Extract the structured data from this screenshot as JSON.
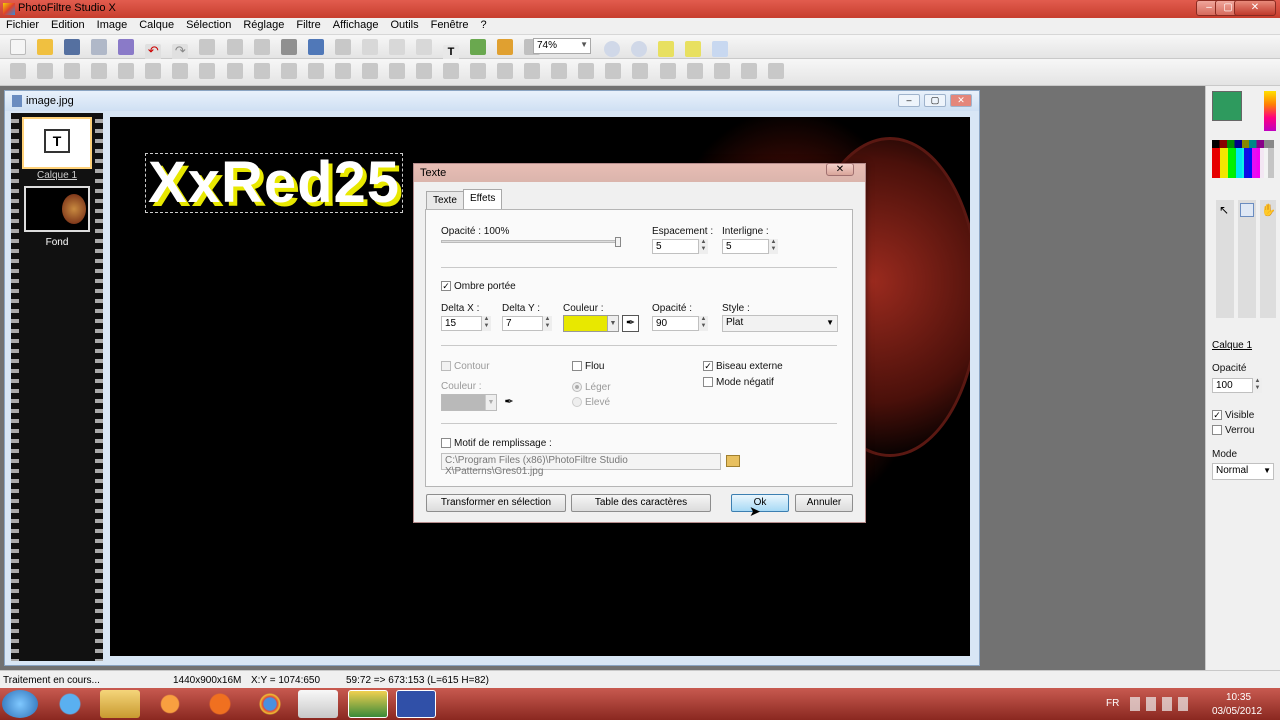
{
  "app": {
    "title": "PhotoFiltre Studio X",
    "win_min": "–",
    "win_max": "▢",
    "win_close": "✕"
  },
  "menu": [
    "Fichier",
    "Edition",
    "Image",
    "Calque",
    "Sélection",
    "Réglage",
    "Filtre",
    "Affichage",
    "Outils",
    "Fenêtre",
    "?"
  ],
  "zoom": {
    "value": "74%"
  },
  "document": {
    "name": "image.jpg",
    "layers": [
      {
        "name": "Calque 1",
        "thumb": "T"
      },
      {
        "name": "Fond"
      }
    ],
    "canvas_text": "XxRed25"
  },
  "dialog": {
    "title": "Texte",
    "close": "✕",
    "tabs": [
      "Texte",
      "Effets"
    ],
    "opacity_label": "Opacité : 100%",
    "opacity_value": 1.0,
    "spacing_label": "Espacement :",
    "spacing_value": "5",
    "interline_label": "Interligne :",
    "interline_value": "5",
    "shadow_label": "Ombre portée",
    "shadow_checked": "✓",
    "dx_label": "Delta X :",
    "dx_value": "15",
    "dy_label": "Delta Y :",
    "dy_value": "7",
    "color_label": "Couleur :",
    "shadow_color": "#e8e800",
    "sh_opacity_label": "Opacité :",
    "sh_opacity_value": "90",
    "style_label": "Style :",
    "style_value": "Plat",
    "contour_label": "Contour",
    "contour_color_label": "Couleur :",
    "flou_label": "Flou",
    "leger_label": "Léger",
    "eleve_label": "Elevé",
    "biseau_label": "Biseau externe",
    "biseau_checked": "✓",
    "negatif_label": "Mode négatif",
    "motif_label": "Motif de remplissage :",
    "motif_path": "C:\\Program Files (x86)\\PhotoFiltre Studio X\\Patterns\\Gres01.jpg",
    "btn_transform": "Transformer en sélection",
    "btn_table": "Table des caractères",
    "btn_ok": "Ok",
    "btn_cancel": "Annuler"
  },
  "right": {
    "fg_color": "#2e9a5e",
    "layer_link": "Calque 1",
    "opacity_label": "Opacité",
    "opacity_value": "100",
    "visible": "Visible",
    "lock": "Verrou",
    "mode_label": "Mode",
    "mode_value": "Normal",
    "check": "✓"
  },
  "status": {
    "state": "Traitement en cours...",
    "size": "1440x900x16M",
    "xy": "X:Y = 1074:650",
    "sel": "59:72 => 673:153 (L=615  H=82)"
  },
  "taskbar": {
    "lang": "FR",
    "time": "10:35",
    "date": "03/05/2012"
  }
}
